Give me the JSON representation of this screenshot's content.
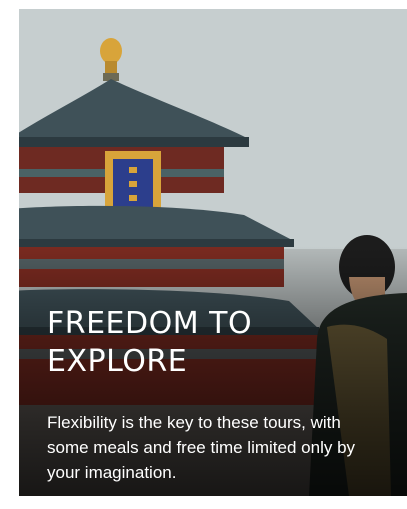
{
  "card": {
    "title": "FREEDOM TO EXPLORE",
    "description": "Flexibility is the key to these tours, with some meals and free time limited only by your imagination.",
    "image_subject": "temple-of-heaven-traveler"
  },
  "colors": {
    "sky": "#c6cecf",
    "roof": "#3f5158",
    "timber": "#7a2a20",
    "gold": "#d8a43a",
    "plaque": "#2c3e8c",
    "text": "#ffffff"
  }
}
